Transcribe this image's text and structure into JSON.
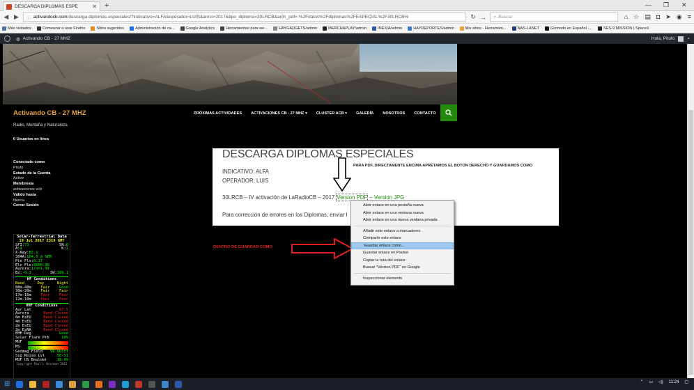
{
  "browser": {
    "tab_title": "DESCARGA DIPLOMAS ESPE",
    "url_prefix": "",
    "url_host": "activandocb.com",
    "url_rest": "/descarga-diplomas-especiales/?indicativo=ALFA&operador=LUIS&anno=2017&tipo_diploma=30LRCB&arch_pdf=.%2Fdatos%2Fdiplomas%2FESPECIAL%2F30LRCB%",
    "search_placeholder": "Buscar"
  },
  "bookmarks": [
    {
      "label": "Más visitados",
      "color": "#4a6fa5"
    },
    {
      "label": "Comenzar a usar Firefox",
      "color": "#333333"
    },
    {
      "label": "Sitios sugeridos",
      "color": "#e08a1e"
    },
    {
      "label": "Administración de ca...",
      "color": "#1a73e8"
    },
    {
      "label": "Google Analytics",
      "color": "#444444"
    },
    {
      "label": "Herramientas para we...",
      "color": "#444444"
    },
    {
      "label": "HAYGADGETS/admin",
      "color": "#888888"
    },
    {
      "label": "MERCHAPLAY/admin",
      "color": "#222222"
    },
    {
      "label": "INEXIA/admin",
      "color": "#2b5ba8"
    },
    {
      "label": "HAYDEPORTES/admin",
      "color": "#3a7bd5"
    },
    {
      "label": "Mis sitios - Herramien...",
      "color": "#e8a33d"
    },
    {
      "label": "NAS-LANET",
      "color": "#1a3c7a"
    },
    {
      "label": "Gizmodo en Español -...",
      "color": "#111111"
    },
    {
      "label": "SES-9 MISSION | SpaceX",
      "color": "#222222"
    }
  ],
  "adminbar": {
    "site_name": "Activando CB - 27 MHZ",
    "greeting": "Hola, Pitufo"
  },
  "site": {
    "title": "Activando CB - 27 MHZ",
    "description": "Radio, Montaña y Naturaleza",
    "nav": [
      "PRÓXIMAS ACTIVIDADES",
      "ACTIVACIONES CB - 27 MHZ",
      "CLUSTER ACB",
      "GALERÍA",
      "NOSOTROS",
      "CONTACTO"
    ],
    "accent": "#24890d",
    "title_color": "#e8a33d"
  },
  "sidebar": {
    "users_online": "0 Usuarios en línea",
    "connected_as_label": "Conectado como",
    "user": "Pitufo",
    "account_status_label": "Estado de la Cuenta",
    "account_status": "Active",
    "membership_label": "Membresía",
    "membership": "activaciones vcb",
    "valid_until_label": "Válido hasta",
    "valid_until": "Nunca",
    "logout": "Cerrar Sesión"
  },
  "solar": {
    "title": "Solar-Terrestrial Data",
    "date": "19 Jul 2017 2319 GMT",
    "rows": [
      {
        "l": "SFI:",
        "lv": "73",
        "r": "SN:",
        "rv": "0"
      },
      {
        "l": "A:",
        "lv": "4",
        "r": "K:",
        "rv": "1"
      },
      {
        "l": "X-Ray:",
        "lv": "B2.1",
        "r": "",
        "rv": ""
      },
      {
        "l": "304A:",
        "lv": "104.0 @ SEM",
        "r": "",
        "rv": ""
      },
      {
        "l": "Ptn Flx:",
        "lv": "0.17",
        "r": "",
        "rv": ""
      },
      {
        "l": "Elc Flx:",
        "lv": "8600.00",
        "r": "",
        "rv": ""
      },
      {
        "l": "Aurora:",
        "lv": "1/n=1.99",
        "r": "",
        "rv": ""
      },
      {
        "l": "Bz:",
        "lv": "-0.3",
        "r": "SW:",
        "rv": "389.1"
      }
    ],
    "hf_title": "HF Conditions",
    "hf_head": [
      "Band",
      "Day",
      "Night"
    ],
    "hf": [
      [
        "80m-40m",
        "Fair",
        "Good"
      ],
      [
        "30m-20m",
        "Fair",
        "Fair"
      ],
      [
        "17m-15m",
        "Poor",
        "Poor"
      ],
      [
        "12m-10m",
        "Poor",
        "Poor"
      ]
    ],
    "vhf_title": "VHF Conditions",
    "vhf": [
      [
        "Aur Lat",
        "67.5"
      ],
      [
        "Aurora",
        "Band Closed"
      ],
      [
        "6m EsEU",
        "Band Closed"
      ],
      [
        "4m EsEU",
        "Band Closed"
      ],
      [
        "2m EsEU",
        "Band Closed"
      ],
      [
        "2m EsNA",
        "Band Closed"
      ],
      [
        "EME Deg",
        "Good"
      ]
    ],
    "flare_label": "Solar Flare Prb",
    "flare_value": "10%",
    "muf_label": "MUF",
    "ms_label": "MS",
    "geomag_label": "Geomag Field",
    "geomag_value": "VR QUIET",
    "noise_label": "Sig Noise Lvl",
    "noise_value": "S0-S1",
    "muf_boulder_label": "MUF US Boulder",
    "muf_boulder_value": "18.09",
    "copyright": "Copyright Paul L Herrman 2012"
  },
  "content": {
    "title": "DESCARGA DIPLOMAS ESPECIALES",
    "pdf_note": "PARA PDF, DIRECTAMENTE ENCIMA APRETAMOS EL BOTON DERECHO Y GUARDAMOS COMO",
    "indicativo": "INDICATIVO: ALFA",
    "operador": "OPERADOR: LUIS",
    "activation_text": "30LRCB – IV activación de LaRadioCB – 2017",
    "pdf_link": "Version PDF",
    "link_sep": "–",
    "jpg_link": "Version JPG",
    "errors_text": "Para corrección de errores en los Diplomas, enviar l"
  },
  "annotation": {
    "inside_label": "DENTRO DE GUARDAR COMO"
  },
  "context_menu": {
    "items": [
      "Abrir enlace en una pestaña nueva",
      "Abrir enlace en una ventana nueva",
      "Abrir enlace en una nueva ventana privada",
      "Añadir este enlace a marcadores",
      "Compartir este enlace",
      "Guardar enlace como...",
      "Guardar enlace en Pocket",
      "Copiar la ruta del enlace",
      "Buscar \"Version PDF\" en Google",
      "Inspeccionar elemento"
    ],
    "highlighted": "Guardar enlace como..."
  },
  "taskbar": {
    "time": "11:24",
    "icons": [
      "windows-start",
      "edge",
      "folder",
      "filezilla",
      "ie",
      "explorer",
      "chrome",
      "firefox",
      "app1",
      "app2",
      "app3",
      "app4",
      "app5",
      "word"
    ]
  }
}
